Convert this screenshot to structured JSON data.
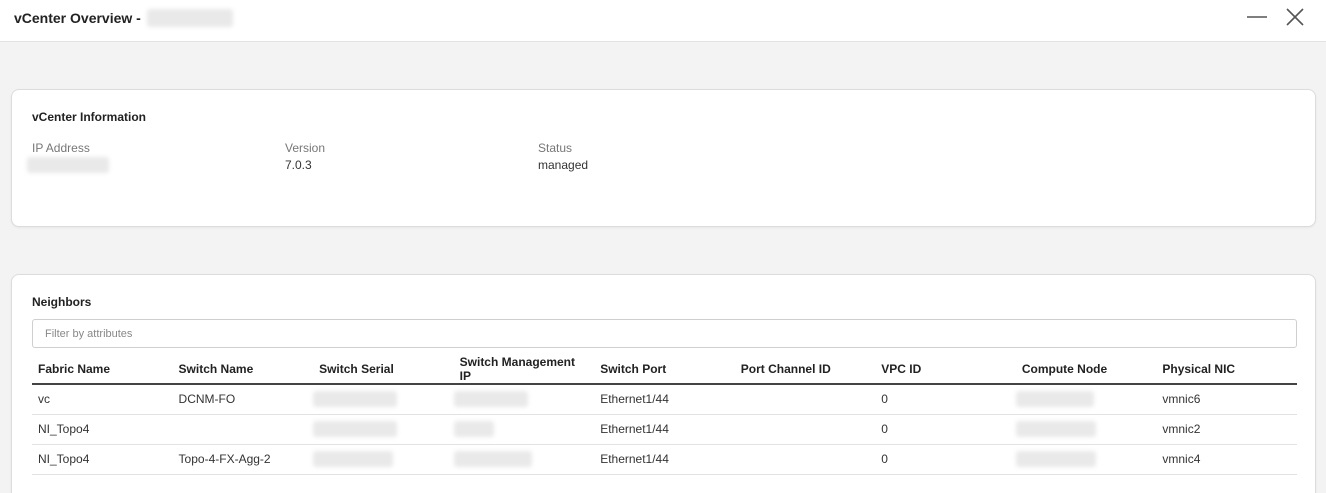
{
  "window": {
    "title": "vCenter Overview -"
  },
  "info": {
    "heading": "vCenter Information",
    "fields": [
      {
        "label": "IP Address",
        "value": ""
      },
      {
        "label": "Version",
        "value": "7.0.3"
      },
      {
        "label": "Status",
        "value": "managed"
      }
    ]
  },
  "neighbors": {
    "heading": "Neighbors",
    "filter_placeholder": "Filter by attributes",
    "columns": [
      "Fabric Name",
      "Switch Name",
      "Switch Serial",
      "Switch Management IP",
      "Switch Port",
      "Port Channel ID",
      "VPC ID",
      "Compute Node",
      "Physical NIC"
    ],
    "rows": [
      {
        "fabric": "vc",
        "switch_name": "DCNM-FO",
        "switch_port": "Ethernet1/44",
        "port_channel_id": "",
        "vpc_id": "0",
        "physical_nic": "vmnic6"
      },
      {
        "fabric": "NI_Topo4",
        "switch_name": "",
        "switch_port": "Ethernet1/44",
        "port_channel_id": "",
        "vpc_id": "0",
        "physical_nic": "vmnic2"
      },
      {
        "fabric": "NI_Topo4",
        "switch_name": "Topo-4-FX-Agg-2",
        "switch_port": "Ethernet1/44",
        "port_channel_id": "",
        "vpc_id": "0",
        "physical_nic": "vmnic4"
      }
    ]
  },
  "icons": {
    "minimize": "minimize-icon",
    "close": "close-icon"
  }
}
